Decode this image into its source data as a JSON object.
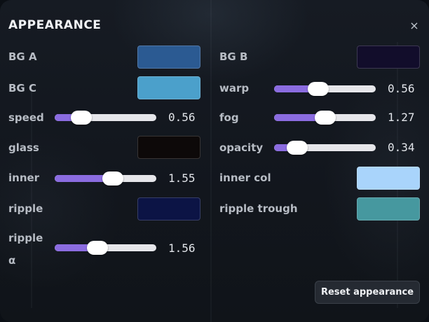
{
  "panel": {
    "title": "APPEARANCE",
    "close_icon": "×",
    "reset_label": "Reset appearance"
  },
  "controls": {
    "bg_a": {
      "label": "BG A",
      "color": "#2b5a92"
    },
    "bg_b": {
      "label": "BG B",
      "color": "#120d2b"
    },
    "bg_c": {
      "label": "BG C",
      "color": "#4ba0cb"
    },
    "warp": {
      "label": "warp",
      "value": "0.56",
      "fraction": 0.42
    },
    "speed": {
      "label": "speed",
      "value": "0.56",
      "fraction": 0.2
    },
    "fog": {
      "label": "fog",
      "value": "1.27",
      "fraction": 0.5
    },
    "glass": {
      "label": "glass",
      "color": "#0d0909"
    },
    "opacity": {
      "label": "opacity",
      "value": "0.34",
      "fraction": 0.16
    },
    "inner": {
      "label": "inner",
      "value": "1.55",
      "fraction": 0.59
    },
    "inner_col": {
      "label": "inner col",
      "color": "#a9d4fb"
    },
    "ripple": {
      "label": "ripple",
      "color": "#0c1445"
    },
    "ripple_trough": {
      "label": "ripple trough",
      "color": "#46989f"
    },
    "ripple_alpha": {
      "label_line1": "ripple",
      "label_line2": "α",
      "value": "1.56",
      "fraction": 0.4
    }
  }
}
